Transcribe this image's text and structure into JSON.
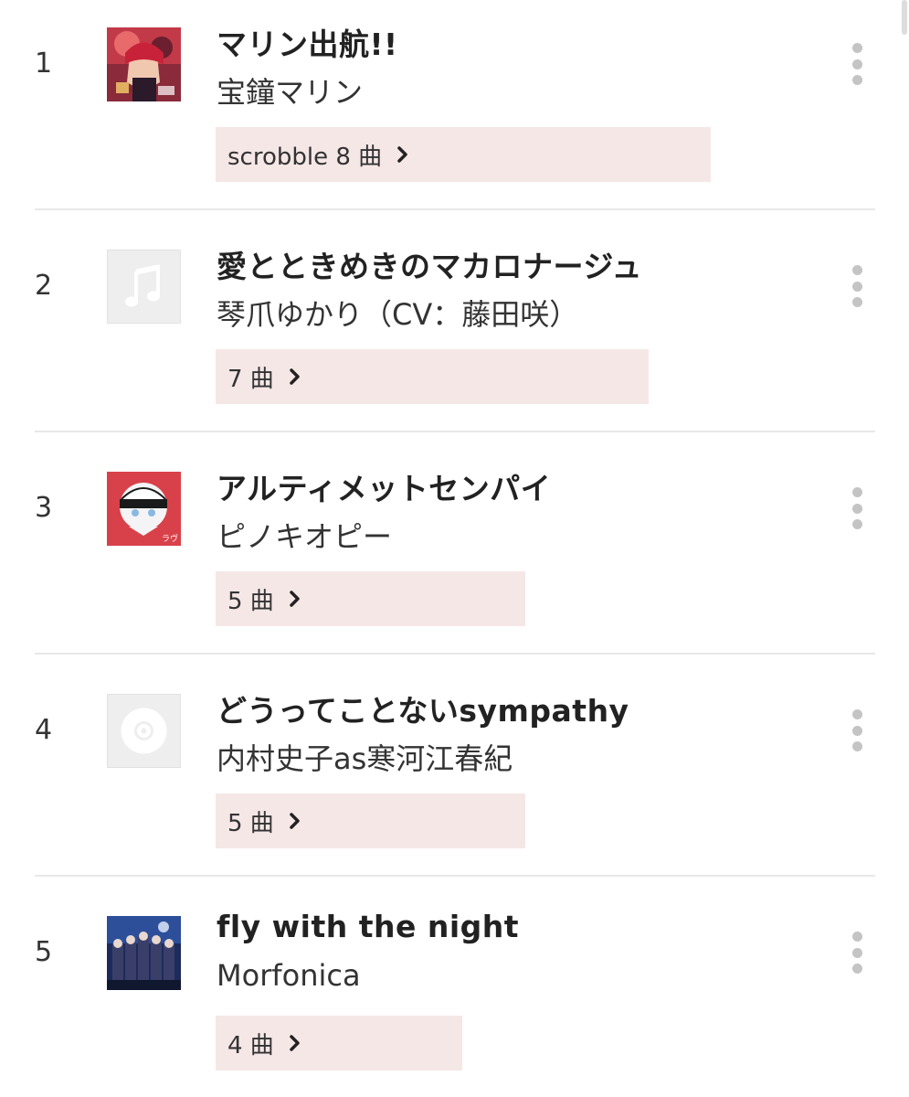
{
  "tracks": [
    {
      "rank": "1",
      "title": "マリン出航!!",
      "artist": "宝鐘マリン",
      "count_label": "scrobble 8 曲",
      "art_icon": "album-art-anime-pirate",
      "colors": {
        "art_bg": "#b8283a"
      }
    },
    {
      "rank": "2",
      "title": "愛とときめきのマカロナージュ",
      "artist": "琴爪ゆかり（CV：藤田咲）",
      "count_label": "7 曲",
      "art_icon": "music-note-placeholder-icon",
      "colors": {
        "art_bg": "#eeeeee"
      }
    },
    {
      "rank": "3",
      "title": "アルティメットセンパイ",
      "artist": "ピノキオピー",
      "count_label": "5 曲",
      "art_icon": "album-art-red-character",
      "colors": {
        "art_bg": "#d9414a"
      }
    },
    {
      "rank": "4",
      "title": "どうってことないsympathy",
      "artist": "内村史子as寒河江春紀",
      "count_label": "5 曲",
      "art_icon": "disc-placeholder-icon",
      "colors": {
        "art_bg": "#eeeeee"
      }
    },
    {
      "rank": "5",
      "title": "fly with the night",
      "artist": "Morfonica",
      "count_label": "4 曲",
      "art_icon": "album-art-group-night",
      "colors": {
        "art_bg": "#1d2b5a"
      }
    }
  ],
  "colors": {
    "count_button_bg": "#f6e7e7",
    "divider": "#e8e8e8",
    "more_dots": "#c4c4c4"
  }
}
